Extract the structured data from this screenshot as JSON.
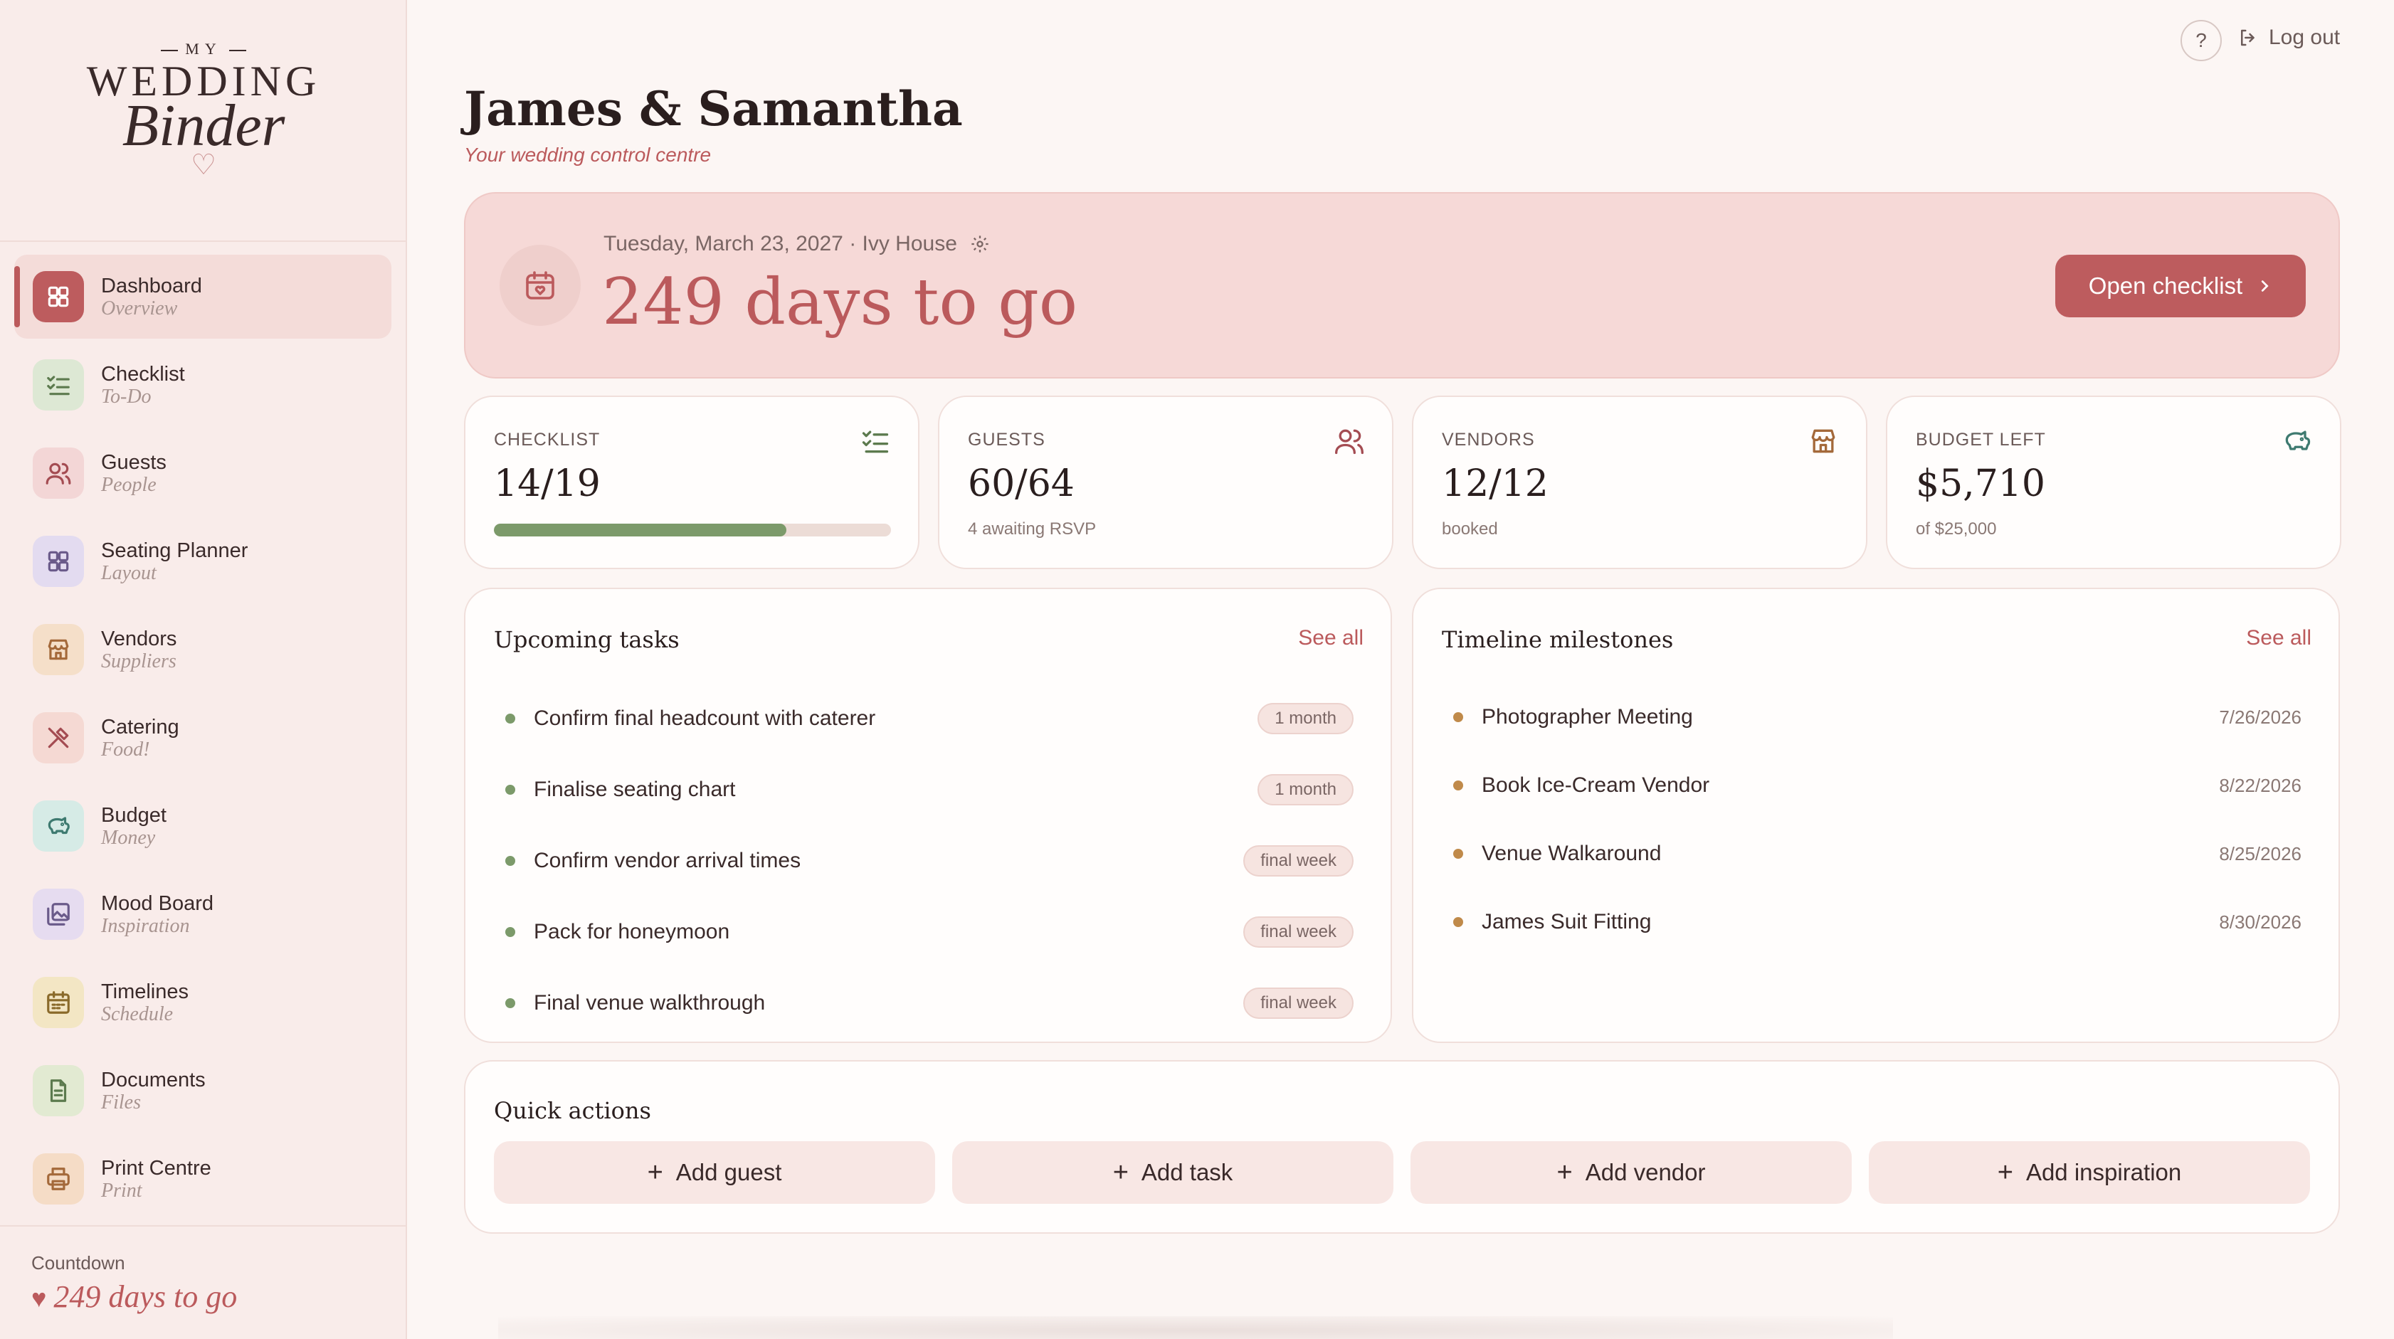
{
  "brand": {
    "line1": "MY",
    "line2": "WEDDING",
    "line3": "Binder",
    "heart": "♡"
  },
  "nav": [
    {
      "label": "Dashboard",
      "sub": "Overview",
      "icon": "grid-icon",
      "bg": "#bd5c5e",
      "fg": "#ffffff",
      "active": true
    },
    {
      "label": "Checklist",
      "sub": "To-Do",
      "icon": "checklist-icon",
      "bg": "#dde8d4",
      "fg": "#5c7a4e"
    },
    {
      "label": "Guests",
      "sub": "People",
      "icon": "users-icon",
      "bg": "#f3d6d6",
      "fg": "#a44c52"
    },
    {
      "label": "Seating Planner",
      "sub": "Layout",
      "icon": "grid-icon",
      "bg": "#e3dbf0",
      "fg": "#6a5a8a"
    },
    {
      "label": "Vendors",
      "sub": "Suppliers",
      "icon": "store-icon",
      "bg": "#f5dfc9",
      "fg": "#a4693a"
    },
    {
      "label": "Catering",
      "sub": "Food!",
      "icon": "utensils-icon",
      "bg": "#f5d9d3",
      "fg": "#a44c52"
    },
    {
      "label": "Budget",
      "sub": "Money",
      "icon": "piggy-bank-icon",
      "bg": "#d6ebe6",
      "fg": "#3e7a70"
    },
    {
      "label": "Mood Board",
      "sub": "Inspiration",
      "icon": "images-icon",
      "bg": "#e6dcf0",
      "fg": "#6a5a8a"
    },
    {
      "label": "Timelines",
      "sub": "Schedule",
      "icon": "calendar-icon",
      "bg": "#f3e6c4",
      "fg": "#8a6a2a"
    },
    {
      "label": "Documents",
      "sub": "Files",
      "icon": "document-icon",
      "bg": "#e2ead2",
      "fg": "#5c7a4e"
    },
    {
      "label": "Print Centre",
      "sub": "Print",
      "icon": "printer-icon",
      "bg": "#f5dcc6",
      "fg": "#a4693a"
    }
  ],
  "countdown": {
    "label": "Countdown",
    "value": "249 days to go"
  },
  "topbar": {
    "help": "?",
    "logout": "Log out"
  },
  "header": {
    "title": "James & Samantha",
    "subtitle": "Your wedding control centre"
  },
  "hero": {
    "date": "Tuesday, March 23, 2027 · Ivy House",
    "days": "249 days to go",
    "button": "Open checklist"
  },
  "stats": [
    {
      "label": "CHECKLIST",
      "value": "14/19",
      "progress": 0.737,
      "icon": "checklist-icon",
      "color": "#5c7a4e"
    },
    {
      "label": "GUESTS",
      "value": "60/64",
      "note": "4 awaiting RSVP",
      "icon": "users-icon",
      "color": "#a44c52"
    },
    {
      "label": "VENDORS",
      "value": "12/12",
      "note": "booked",
      "icon": "store-icon",
      "color": "#a4693a"
    },
    {
      "label": "BUDGET LEFT",
      "value": "$5,710",
      "note": "of $25,000",
      "icon": "piggy-bank-icon",
      "color": "#3e7a70"
    }
  ],
  "tasks": {
    "title": "Upcoming tasks",
    "see_all": "See all",
    "items": [
      {
        "text": "Confirm final headcount with caterer",
        "tag": "1 month"
      },
      {
        "text": "Finalise seating chart",
        "tag": "1 month"
      },
      {
        "text": "Confirm vendor arrival times",
        "tag": "final week"
      },
      {
        "text": "Pack for honeymoon",
        "tag": "final week"
      },
      {
        "text": "Final venue walkthrough",
        "tag": "final week"
      }
    ]
  },
  "milestones": {
    "title": "Timeline milestones",
    "see_all": "See all",
    "items": [
      {
        "text": "Photographer Meeting",
        "date": "7/26/2026"
      },
      {
        "text": "Book Ice-Cream Vendor",
        "date": "8/22/2026"
      },
      {
        "text": "Venue Walkaround",
        "date": "8/25/2026"
      },
      {
        "text": "James Suit Fitting",
        "date": "8/30/2026"
      }
    ]
  },
  "quick_actions": {
    "title": "Quick actions",
    "buttons": [
      "Add guest",
      "Add task",
      "Add vendor",
      "Add inspiration"
    ]
  },
  "colors": {
    "accent": "#bd5c5e",
    "task_dot": "#7c9a6a",
    "milestone_dot": "#c08a4a"
  }
}
